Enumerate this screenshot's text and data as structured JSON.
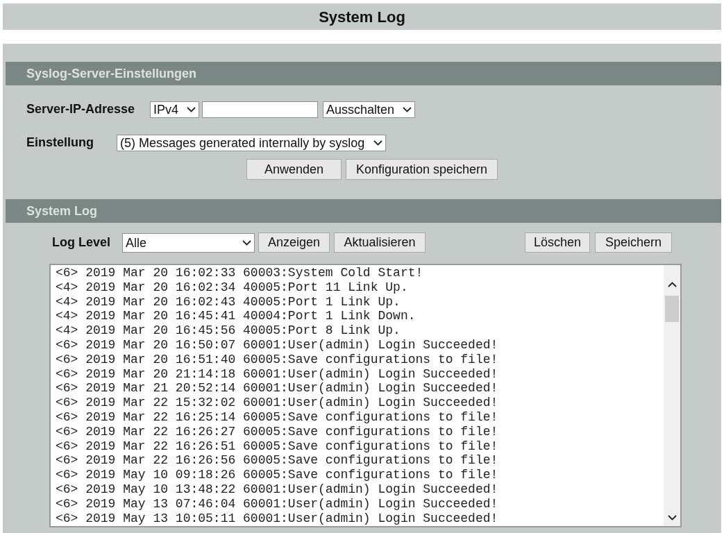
{
  "page_title": "System Log",
  "syslog_server_settings": {
    "title": "Syslog-Server-Einstellungen",
    "server_ip": {
      "label": "Server-IP-Adresse",
      "protocol": "IPv4",
      "mode": "Ausschalten"
    },
    "setting": {
      "label": "Einstellung",
      "value": "(5) Messages generated internally by syslog"
    },
    "buttons": [
      "Anwenden",
      "Konfiguration speichern"
    ]
  },
  "system_log": {
    "title": "System Log",
    "log_level": {
      "label": "Log Level",
      "value": "Alle"
    },
    "buttons": [
      "Anzeigen",
      "Aktualisieren"
    ],
    "right_buttons": [
      "Löschen",
      "Speichern"
    ],
    "lines": [
      "<6> 2019 Mar 20 16:02:33 60003:System Cold Start!",
      "<4> 2019 Mar 20 16:02:34 40005:Port 11 Link Up.",
      "<4> 2019 Mar 20 16:02:43 40005:Port 1 Link Up.",
      "<4> 2019 Mar 20 16:45:41 40004:Port 1 Link Down.",
      "<4> 2019 Mar 20 16:45:56 40005:Port 8 Link Up.",
      "<6> 2019 Mar 20 16:50:07 60001:User(admin) Login Succeeded!",
      "<6> 2019 Mar 20 16:51:40 60005:Save configurations to file!",
      "<6> 2019 Mar 20 21:14:18 60001:User(admin) Login Succeeded!",
      "<6> 2019 Mar 21 20:52:14 60001:User(admin) Login Succeeded!",
      "<6> 2019 Mar 22 15:32:02 60001:User(admin) Login Succeeded!",
      "<6> 2019 Mar 22 16:25:14 60005:Save configurations to file!",
      "<6> 2019 Mar 22 16:26:27 60005:Save configurations to file!",
      "<6> 2019 Mar 22 16:26:51 60005:Save configurations to file!",
      "<6> 2019 Mar 22 16:26:56 60005:Save configurations to file!",
      "<6> 2019 May 10 09:18:26 60005:Save configurations to file!",
      "<6> 2019 May 10 13:48:22 60001:User(admin) Login Succeeded!",
      "<6> 2019 May 13 07:46:04 60001:User(admin) Login Succeeded!",
      "<6> 2019 May 13 10:05:11 60001:User(admin) Login Succeeded!"
    ]
  }
}
